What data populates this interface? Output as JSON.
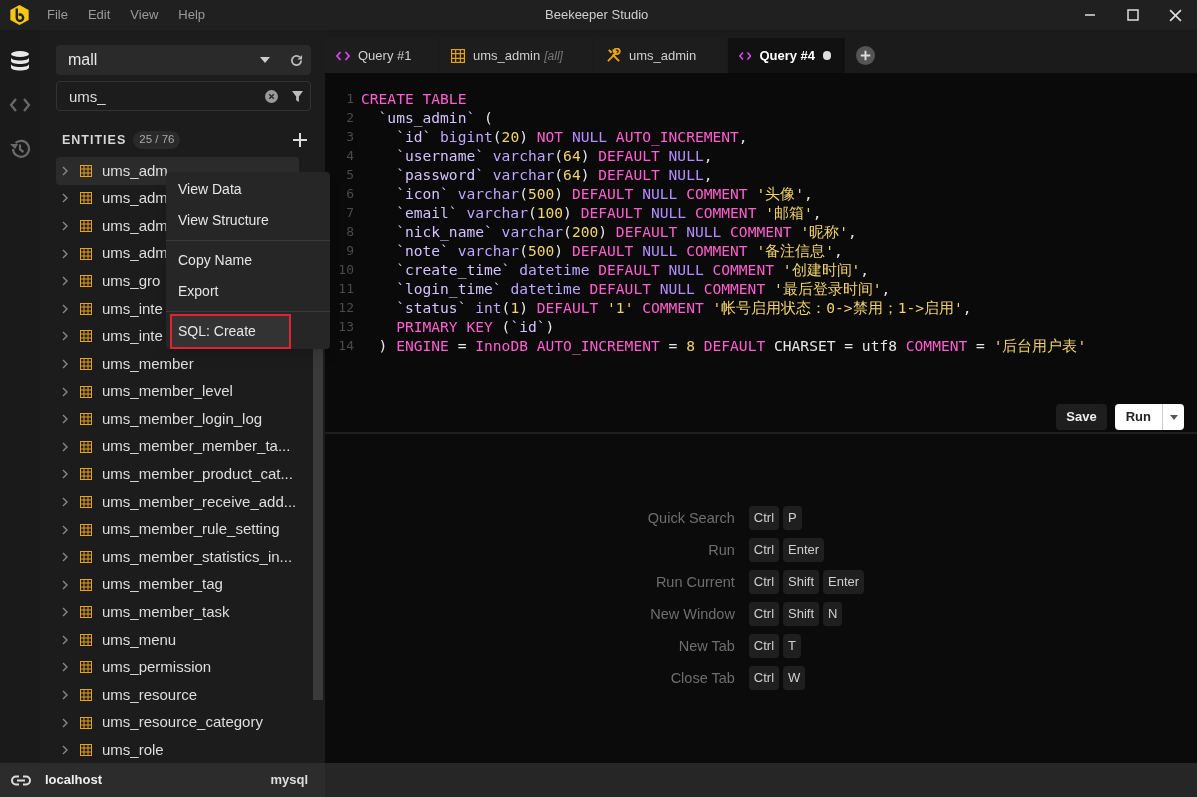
{
  "window": {
    "title": "Beekeeper Studio",
    "menu": [
      "File",
      "Edit",
      "View",
      "Help"
    ]
  },
  "rail": [
    {
      "kind": "database",
      "selected": true
    },
    {
      "kind": "code",
      "selected": false
    },
    {
      "kind": "history",
      "selected": false
    }
  ],
  "sidebar": {
    "database": "mall",
    "filter": {
      "value": "ums_"
    },
    "entities_label": "ENTITIES",
    "entities_count": "25 / 76",
    "items": [
      {
        "name": "ums_adm",
        "selected": true
      },
      {
        "name": "ums_adm",
        "selected": false
      },
      {
        "name": "ums_adm",
        "selected": false
      },
      {
        "name": "ums_adm",
        "selected": false
      },
      {
        "name": "ums_gro",
        "selected": false
      },
      {
        "name": "ums_inte",
        "selected": false
      },
      {
        "name": "ums_inte",
        "selected": false
      },
      {
        "name": "ums_member",
        "selected": false
      },
      {
        "name": "ums_member_level",
        "selected": false
      },
      {
        "name": "ums_member_login_log",
        "selected": false
      },
      {
        "name": "ums_member_member_ta...",
        "selected": false
      },
      {
        "name": "ums_member_product_cat...",
        "selected": false
      },
      {
        "name": "ums_member_receive_add...",
        "selected": false
      },
      {
        "name": "ums_member_rule_setting",
        "selected": false
      },
      {
        "name": "ums_member_statistics_in...",
        "selected": false
      },
      {
        "name": "ums_member_tag",
        "selected": false
      },
      {
        "name": "ums_member_task",
        "selected": false
      },
      {
        "name": "ums_menu",
        "selected": false
      },
      {
        "name": "ums_permission",
        "selected": false
      },
      {
        "name": "ums_resource",
        "selected": false
      },
      {
        "name": "ums_resource_category",
        "selected": false
      },
      {
        "name": "ums_role",
        "selected": false
      }
    ]
  },
  "context_menu": {
    "groups": [
      [
        {
          "label": "View Data",
          "selected": false
        },
        {
          "label": "View Structure",
          "selected": false
        }
      ],
      [
        {
          "label": "Copy Name",
          "selected": false
        },
        {
          "label": "Export",
          "selected": false
        }
      ],
      [
        {
          "label": "SQL: Create",
          "selected": true
        }
      ]
    ]
  },
  "tabs": [
    {
      "kind": "query",
      "label": "Query #1",
      "selected": false,
      "unsaved": false
    },
    {
      "kind": "table",
      "label": "ums_admin",
      "suffix": "[all]",
      "selected": false,
      "unsaved": false
    },
    {
      "kind": "structure",
      "label": "ums_admin",
      "selected": false,
      "unsaved": false
    },
    {
      "kind": "query",
      "label": "Query #4",
      "selected": true,
      "unsaved": true
    }
  ],
  "editor": {
    "lines": [
      {
        "number": "1",
        "tokens": [
          {
            "kind": "keyword",
            "text": "CREATE TABLE"
          }
        ]
      },
      {
        "number": "2",
        "tokens": [
          {
            "kind": "ident",
            "text": "  `ums_admin`"
          },
          {
            "kind": "plain",
            "text": " ("
          }
        ]
      },
      {
        "number": "3",
        "tokens": [
          {
            "kind": "ident",
            "text": "    `id` "
          },
          {
            "kind": "type",
            "text": "bigint"
          },
          {
            "kind": "plain",
            "text": "("
          },
          {
            "kind": "number",
            "text": "20"
          },
          {
            "kind": "plain",
            "text": ") "
          },
          {
            "kind": "keyword",
            "text": "NOT "
          },
          {
            "kind": "null",
            "text": "NULL "
          },
          {
            "kind": "keyword",
            "text": "AUTO_INCREMENT"
          },
          {
            "kind": "plain",
            "text": ","
          }
        ]
      },
      {
        "number": "4",
        "tokens": [
          {
            "kind": "ident",
            "text": "    `username` "
          },
          {
            "kind": "type",
            "text": "varchar"
          },
          {
            "kind": "plain",
            "text": "("
          },
          {
            "kind": "number",
            "text": "64"
          },
          {
            "kind": "plain",
            "text": ") "
          },
          {
            "kind": "keyword",
            "text": "DEFAULT "
          },
          {
            "kind": "null",
            "text": "NULL"
          },
          {
            "kind": "plain",
            "text": ","
          }
        ]
      },
      {
        "number": "5",
        "tokens": [
          {
            "kind": "ident",
            "text": "    `password` "
          },
          {
            "kind": "type",
            "text": "varchar"
          },
          {
            "kind": "plain",
            "text": "("
          },
          {
            "kind": "number",
            "text": "64"
          },
          {
            "kind": "plain",
            "text": ") "
          },
          {
            "kind": "keyword",
            "text": "DEFAULT "
          },
          {
            "kind": "null",
            "text": "NULL"
          },
          {
            "kind": "plain",
            "text": ","
          }
        ]
      },
      {
        "number": "6",
        "tokens": [
          {
            "kind": "ident",
            "text": "    `icon` "
          },
          {
            "kind": "type",
            "text": "varchar"
          },
          {
            "kind": "plain",
            "text": "("
          },
          {
            "kind": "number",
            "text": "500"
          },
          {
            "kind": "plain",
            "text": ") "
          },
          {
            "kind": "keyword",
            "text": "DEFAULT "
          },
          {
            "kind": "null",
            "text": "NULL "
          },
          {
            "kind": "keyword",
            "text": "COMMENT "
          },
          {
            "kind": "string",
            "text": "'头像'"
          },
          {
            "kind": "plain",
            "text": ","
          }
        ]
      },
      {
        "number": "7",
        "tokens": [
          {
            "kind": "ident",
            "text": "    `email` "
          },
          {
            "kind": "type",
            "text": "varchar"
          },
          {
            "kind": "plain",
            "text": "("
          },
          {
            "kind": "number",
            "text": "100"
          },
          {
            "kind": "plain",
            "text": ") "
          },
          {
            "kind": "keyword",
            "text": "DEFAULT "
          },
          {
            "kind": "null",
            "text": "NULL "
          },
          {
            "kind": "keyword",
            "text": "COMMENT "
          },
          {
            "kind": "string",
            "text": "'邮箱'"
          },
          {
            "kind": "plain",
            "text": ","
          }
        ]
      },
      {
        "number": "8",
        "tokens": [
          {
            "kind": "ident",
            "text": "    `nick_name` "
          },
          {
            "kind": "type",
            "text": "varchar"
          },
          {
            "kind": "plain",
            "text": "("
          },
          {
            "kind": "number",
            "text": "200"
          },
          {
            "kind": "plain",
            "text": ") "
          },
          {
            "kind": "keyword",
            "text": "DEFAULT "
          },
          {
            "kind": "null",
            "text": "NULL "
          },
          {
            "kind": "keyword",
            "text": "COMMENT "
          },
          {
            "kind": "string",
            "text": "'昵称'"
          },
          {
            "kind": "plain",
            "text": ","
          }
        ]
      },
      {
        "number": "9",
        "tokens": [
          {
            "kind": "ident",
            "text": "    `note` "
          },
          {
            "kind": "type",
            "text": "varchar"
          },
          {
            "kind": "plain",
            "text": "("
          },
          {
            "kind": "number",
            "text": "500"
          },
          {
            "kind": "plain",
            "text": ") "
          },
          {
            "kind": "keyword",
            "text": "DEFAULT "
          },
          {
            "kind": "null",
            "text": "NULL "
          },
          {
            "kind": "keyword",
            "text": "COMMENT "
          },
          {
            "kind": "string",
            "text": "'备注信息'"
          },
          {
            "kind": "plain",
            "text": ","
          }
        ]
      },
      {
        "number": "10",
        "tokens": [
          {
            "kind": "ident",
            "text": "    `create_time` "
          },
          {
            "kind": "type",
            "text": "datetime "
          },
          {
            "kind": "keyword",
            "text": "DEFAULT "
          },
          {
            "kind": "null",
            "text": "NULL "
          },
          {
            "kind": "keyword",
            "text": "COMMENT "
          },
          {
            "kind": "string",
            "text": "'创建时间'"
          },
          {
            "kind": "plain",
            "text": ","
          }
        ]
      },
      {
        "number": "11",
        "tokens": [
          {
            "kind": "ident",
            "text": "    `login_time` "
          },
          {
            "kind": "type",
            "text": "datetime "
          },
          {
            "kind": "keyword",
            "text": "DEFAULT "
          },
          {
            "kind": "null",
            "text": "NULL "
          },
          {
            "kind": "keyword",
            "text": "COMMENT "
          },
          {
            "kind": "string",
            "text": "'最后登录时间'"
          },
          {
            "kind": "plain",
            "text": ","
          }
        ]
      },
      {
        "number": "12",
        "tokens": [
          {
            "kind": "ident",
            "text": "    `status` "
          },
          {
            "kind": "type",
            "text": "int"
          },
          {
            "kind": "plain",
            "text": "("
          },
          {
            "kind": "number",
            "text": "1"
          },
          {
            "kind": "plain",
            "text": ") "
          },
          {
            "kind": "keyword",
            "text": "DEFAULT "
          },
          {
            "kind": "string",
            "text": "'1' "
          },
          {
            "kind": "keyword",
            "text": "COMMENT "
          },
          {
            "kind": "string",
            "text": "'帐号启用状态：0->禁用；1->启用'"
          },
          {
            "kind": "plain",
            "text": ","
          }
        ]
      },
      {
        "number": "13",
        "tokens": [
          {
            "kind": "keyword",
            "text": "    PRIMARY KEY "
          },
          {
            "kind": "plain",
            "text": "("
          },
          {
            "kind": "ident",
            "text": "`id`"
          },
          {
            "kind": "plain",
            "text": ")"
          }
        ]
      },
      {
        "number": "14",
        "tokens": [
          {
            "kind": "plain",
            "text": "  ) "
          },
          {
            "kind": "keyword",
            "text": "ENGINE "
          },
          {
            "kind": "plain",
            "text": "= "
          },
          {
            "kind": "keyword",
            "text": "InnoDB AUTO_INCREMENT "
          },
          {
            "kind": "plain",
            "text": "= "
          },
          {
            "kind": "number",
            "text": "8 "
          },
          {
            "kind": "keyword",
            "text": "DEFAULT "
          },
          {
            "kind": "plain",
            "text": "CHARSET = utf8 "
          },
          {
            "kind": "keyword",
            "text": "COMMENT "
          },
          {
            "kind": "plain",
            "text": "= "
          },
          {
            "kind": "string",
            "text": "'后台用户表'"
          }
        ]
      }
    ],
    "buttons": {
      "save": "Save",
      "run": "Run"
    }
  },
  "shortcuts": [
    {
      "label": "Quick Search",
      "keys": [
        "Ctrl",
        "P"
      ]
    },
    {
      "label": "Run",
      "keys": [
        "Ctrl",
        "Enter"
      ]
    },
    {
      "label": "Run Current",
      "keys": [
        "Ctrl",
        "Shift",
        "Enter"
      ]
    },
    {
      "label": "New Window",
      "keys": [
        "Ctrl",
        "Shift",
        "N"
      ]
    },
    {
      "label": "New Tab",
      "keys": [
        "Ctrl",
        "T"
      ]
    },
    {
      "label": "Close Tab",
      "keys": [
        "Ctrl",
        "W"
      ]
    }
  ],
  "status_bar": {
    "connection": "localhost",
    "driver": "mysql"
  }
}
